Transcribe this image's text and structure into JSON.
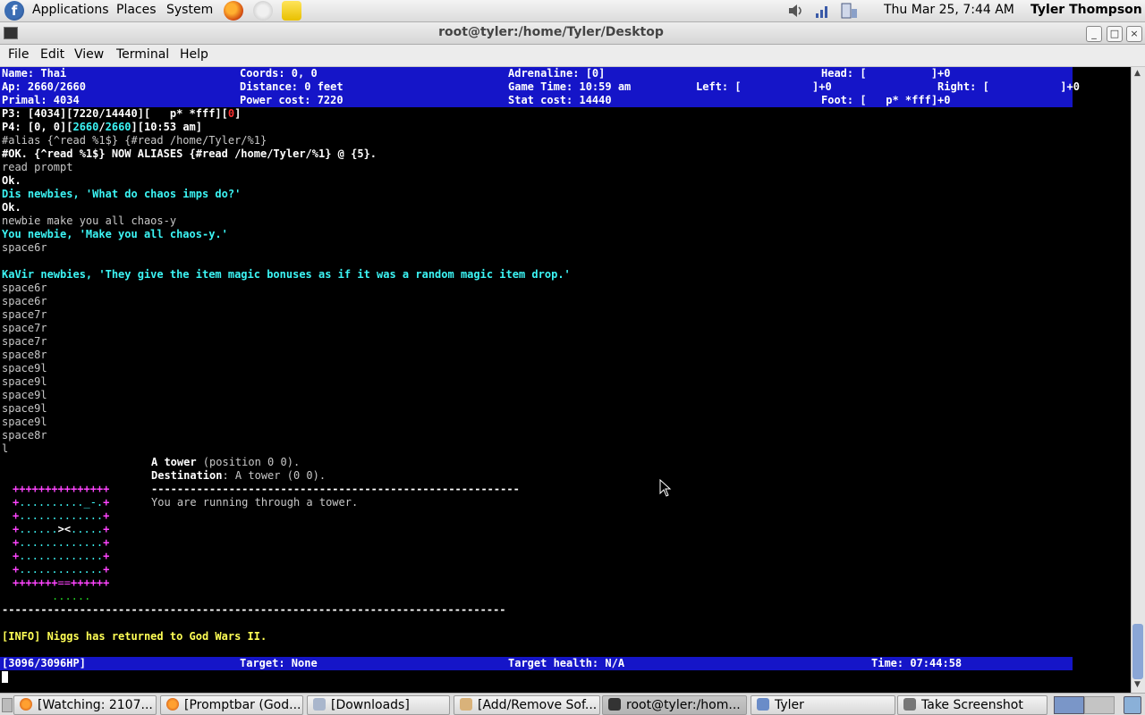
{
  "panel": {
    "applications": "Applications",
    "places": "Places",
    "system": "System",
    "clock": "Thu Mar 25,  7:44 AM",
    "user": "Tyler Thompson"
  },
  "window": {
    "title": "root@tyler:/home/Tyler/Desktop",
    "menu": {
      "file": "File",
      "edit": "Edit",
      "view": "View",
      "terminal": "Terminal",
      "help": "Help"
    }
  },
  "status_top": {
    "row1": {
      "name": "Name: Thai",
      "coords": "Coords: 0, 0",
      "adrenaline": "Adrenaline: [0]",
      "head": "Head: [          ]+0"
    },
    "row2": {
      "ap": "Ap: 2660/2660",
      "distance": "Distance: 0 feet",
      "game_time": "Game Time: 10:59 am",
      "left": "Left: [           ]+0",
      "right": "Right: [           ]+0"
    },
    "row3": {
      "primal": "Primal: 4034",
      "power": "Power cost: 7220",
      "stat": "Stat cost: 14440",
      "foot": "Foot: [   p* *fff]+0"
    }
  },
  "output": {
    "p3_a": "P3: [4034][7220/14440][   p* *fff][",
    "p3_b": "0",
    "p3_c": "]",
    "p4_a": "P4: [0, 0][",
    "p4_b": "2660",
    "p4_c": "/",
    "p4_d": "2660",
    "p4_e": "][10:53 am]",
    "l3": "#alias {^read %1$} {#read /home/Tyler/%1}",
    "l4": "#OK. {^read %1$} NOW ALIASES {#read /home/Tyler/%1} @ {5}.",
    "l5": "read prompt",
    "l6": "Ok.",
    "l7": "Dis newbies, 'What do chaos imps do?'",
    "l8": "Ok.",
    "l9": "newbie make you all chaos-y",
    "l10": "You newbie, 'Make you all chaos-y.'",
    "l11": "space6r",
    "l13": "KaVir newbies, 'They give the item magic bonuses as if it was a random magic item drop.'",
    "moves": [
      "space6r",
      "space6r",
      "space7r",
      "space7r",
      "space7r",
      "space8r",
      "space9l",
      "space9l",
      "space9l",
      "space9l",
      "space9l",
      "space8r",
      "l"
    ]
  },
  "room": {
    "name": "A tower",
    "position": " (position 0 0).",
    "dest_label": "Destination",
    "dest_value": ": A tower (0 0).",
    "divider": "---------------------------------------------------------",
    "desc": "You are running through a tower.",
    "map": {
      "r1": "+++++++++++++++",
      "r2a": "+",
      "r2b": ".........._-.",
      "r2c": "+",
      "r3a": "+",
      "r3b": ".............",
      "r3c": "+",
      "r4a": "+",
      "r4b": "......",
      "r4c": "><",
      "r4d": ".....",
      "r4e": "+",
      "r5a": "+",
      "r5b": ".............",
      "r5c": "+",
      "r6a": "+",
      "r6b": ".............",
      "r6c": "+",
      "r7a": "+",
      "r7b": ".............",
      "r7c": "+",
      "r8a": "+++++++",
      "r8b": "==",
      "r8c": "++++++",
      "r9": "......"
    },
    "long_divider": "------------------------------------------------------------------------------"
  },
  "info": "[INFO] Niggs has returned to God Wars II.",
  "status_bottom": {
    "hp": "[3096/3096HP]",
    "target": "Target: None",
    "target_health": "Target health: N/A",
    "time": "Time: 07:44:58"
  },
  "taskbar": {
    "t1": "[Watching: 2107...",
    "t2": "[Promptbar (God...",
    "t3": "[Downloads]",
    "t4": "[Add/Remove Sof...",
    "t5": "root@tyler:/hom...",
    "t6": "Tyler",
    "t7": "Take Screenshot"
  },
  "colors": {
    "status_bar": "#1515c8",
    "cyan": "#3cf5f5",
    "yellow": "#ffff55",
    "magenta": "#ff44ff"
  }
}
